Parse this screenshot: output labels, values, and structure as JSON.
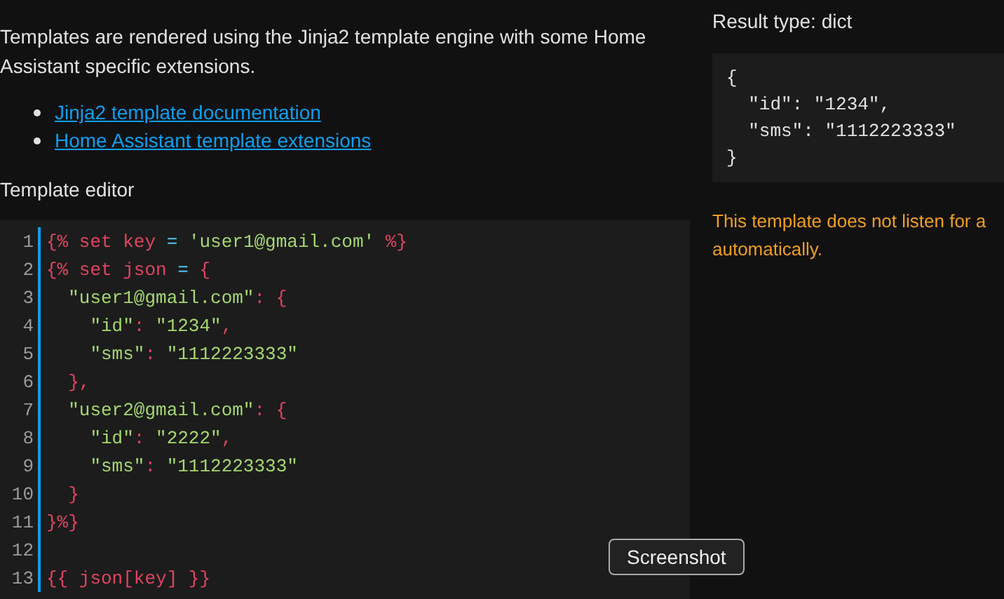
{
  "intro": "Templates are rendered using the Jinja2 template engine with some Home Assistant specific extensions.",
  "links": [
    "Jinja2 template documentation",
    "Home Assistant template extensions"
  ],
  "editor_label": "Template editor",
  "editor": {
    "lines": [
      {
        "number": "1",
        "tokens": [
          {
            "kind": "tag",
            "text": "{% set key "
          },
          {
            "kind": "op",
            "text": "="
          },
          {
            "kind": "str",
            "text": " 'user1@gmail.com' "
          },
          {
            "kind": "tag",
            "text": "%}"
          }
        ]
      },
      {
        "number": "2",
        "tokens": [
          {
            "kind": "tag",
            "text": "{% set json "
          },
          {
            "kind": "op",
            "text": "="
          },
          {
            "kind": "tag",
            "text": " {"
          }
        ]
      },
      {
        "number": "3",
        "tokens": [
          {
            "kind": "str",
            "text": "  \"user1@gmail.com\""
          },
          {
            "kind": "tag",
            "text": ": {"
          }
        ]
      },
      {
        "number": "4",
        "tokens": [
          {
            "kind": "str",
            "text": "    \"id\""
          },
          {
            "kind": "tag",
            "text": ": "
          },
          {
            "kind": "str",
            "text": "\"1234\""
          },
          {
            "kind": "tag",
            "text": ","
          }
        ]
      },
      {
        "number": "5",
        "tokens": [
          {
            "kind": "str",
            "text": "    \"sms\""
          },
          {
            "kind": "tag",
            "text": ": "
          },
          {
            "kind": "str",
            "text": "\"1112223333\""
          }
        ]
      },
      {
        "number": "6",
        "tokens": [
          {
            "kind": "tag",
            "text": "  },"
          }
        ]
      },
      {
        "number": "7",
        "tokens": [
          {
            "kind": "str",
            "text": "  \"user2@gmail.com\""
          },
          {
            "kind": "tag",
            "text": ": {"
          }
        ]
      },
      {
        "number": "8",
        "tokens": [
          {
            "kind": "str",
            "text": "    \"id\""
          },
          {
            "kind": "tag",
            "text": ": "
          },
          {
            "kind": "str",
            "text": "\"2222\""
          },
          {
            "kind": "tag",
            "text": ","
          }
        ]
      },
      {
        "number": "9",
        "tokens": [
          {
            "kind": "str",
            "text": "    \"sms\""
          },
          {
            "kind": "tag",
            "text": ": "
          },
          {
            "kind": "str",
            "text": "\"1112223333\""
          }
        ]
      },
      {
        "number": "10",
        "tokens": [
          {
            "kind": "tag",
            "text": "  }"
          }
        ]
      },
      {
        "number": "11",
        "tokens": [
          {
            "kind": "tag",
            "text": "}%}"
          }
        ]
      },
      {
        "number": "12"
      },
      {
        "number": "13",
        "tokens": [
          {
            "kind": "tag",
            "text": "{{ json[key] }}"
          }
        ]
      }
    ]
  },
  "tooltip": "Screenshot",
  "result": {
    "type_label": "Result type: dict",
    "lines": [
      "{",
      "  \"id\": \"1234\",",
      "  \"sms\": \"1112223333\"",
      "}"
    ]
  },
  "warning_lines": [
    "This template does not listen for a",
    "automatically."
  ]
}
